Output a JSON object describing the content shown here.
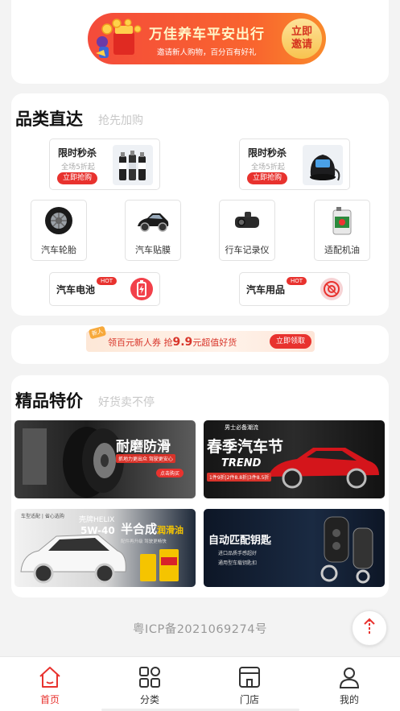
{
  "invite": {
    "title": "万佳养车平安出行",
    "subtitle": "邀请新人购物，百分百有好礼",
    "button": "立即邀请"
  },
  "category": {
    "title": "品类直达",
    "subtitle": "抢先加购",
    "flash_sales": [
      {
        "title": "限时秒杀",
        "sub": "全场5折起",
        "button": "立即抢购",
        "icon": "spray-cans-icon"
      },
      {
        "title": "限时秒杀",
        "sub": "全场5折起",
        "button": "立即抢购",
        "icon": "air-pump-icon"
      }
    ],
    "items": [
      {
        "label": "汽车轮胎",
        "icon": "tire-icon"
      },
      {
        "label": "汽车贴膜",
        "icon": "car-film-icon"
      },
      {
        "label": "行车记录仪",
        "icon": "dashcam-icon"
      },
      {
        "label": "适配机油",
        "icon": "oil-bottle-icon"
      }
    ],
    "hot": [
      {
        "label": "汽车电池",
        "badge": "HOT",
        "icon": "battery-icon"
      },
      {
        "label": "汽车用品",
        "badge": "HOT",
        "icon": "supplies-icon"
      }
    ]
  },
  "coupon": {
    "tag": "新人",
    "text_prefix": "领百元新人券 抢",
    "amount": "9.9",
    "text_suffix": "元超值好货",
    "button": "立即领取"
  },
  "picks": {
    "title": "精品特价",
    "subtitle": "好货卖不停",
    "promos": [
      {
        "headline": "耐磨防滑",
        "tagline": "抓地力更出众 驾驶更安心",
        "button": "点击购买"
      },
      {
        "kicker": "男士必备潮流",
        "headline": "春季汽车节",
        "sub": "TREND",
        "tagline": "1件9折|2件8.8折|3件8.5折"
      },
      {
        "kicker": "车型适配 | 省心选购",
        "brand": "壳牌HELIX",
        "grade": "5W-40",
        "headline": "半合成",
        "headline2": "润滑油",
        "tagline": "配件再升级 驾驶更畅快"
      },
      {
        "headline": "自动匹配钥匙",
        "line1": "进口品质手感超好",
        "line2": "通用型车载钥匙扣"
      }
    ]
  },
  "footer": {
    "icp": "粤ICP备2021069274号"
  },
  "tabs": [
    {
      "label": "首页",
      "icon": "home-icon",
      "active": true
    },
    {
      "label": "分类",
      "icon": "grid-icon",
      "active": false
    },
    {
      "label": "门店",
      "icon": "store-icon",
      "active": false
    },
    {
      "label": "我的",
      "icon": "user-icon",
      "active": false
    }
  ],
  "colors": {
    "accent": "#e8322e",
    "background": "#f3f3f3"
  }
}
